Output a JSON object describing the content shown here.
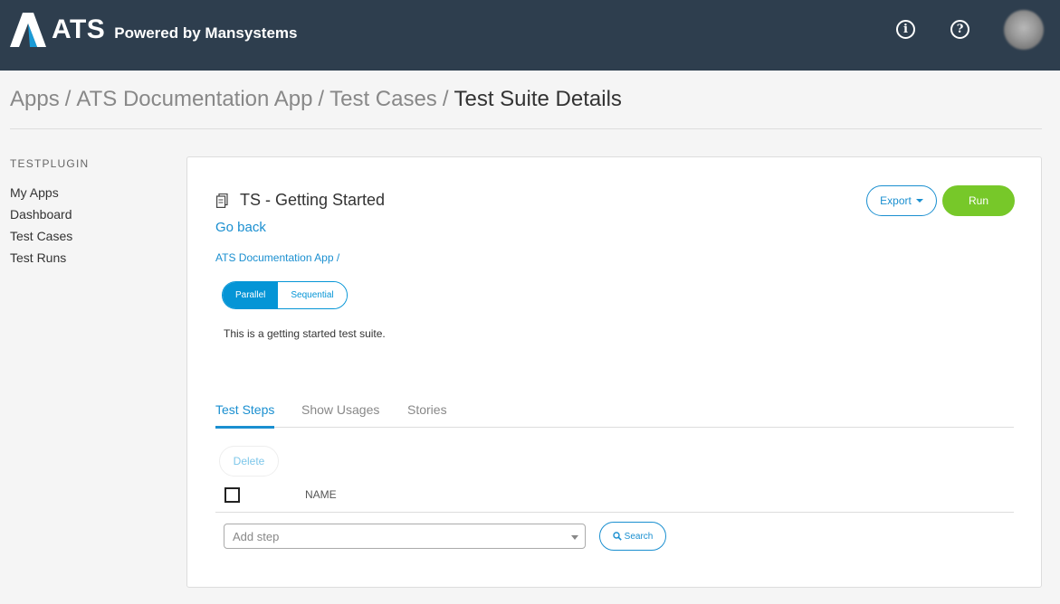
{
  "header": {
    "logo_text": "ATS",
    "powered_by": "Powered by Mansystems",
    "info_icon": "info-icon",
    "help_icon": "help-icon"
  },
  "breadcrumb": {
    "items": [
      "Apps",
      "ATS Documentation App",
      "Test Cases"
    ],
    "separator": "/",
    "current": "Test Suite Details"
  },
  "sidebar": {
    "section": "TESTPLUGIN",
    "items": [
      {
        "label": "My Apps"
      },
      {
        "label": "Dashboard"
      },
      {
        "label": "Test Cases"
      },
      {
        "label": "Test Runs"
      }
    ]
  },
  "suite": {
    "title": "TS - Getting Started",
    "go_back": "Go back",
    "app_link": "ATS Documentation App",
    "app_link_sep": "/",
    "mode_parallel": "Parallel",
    "mode_sequential": "Sequential",
    "mode_selected": "Parallel",
    "description": "This is a getting started test suite.",
    "export_label": "Export",
    "run_label": "Run"
  },
  "tabs": [
    {
      "label": "Test Steps",
      "active": true
    },
    {
      "label": "Show Usages",
      "active": false
    },
    {
      "label": "Stories",
      "active": false
    }
  ],
  "steps": {
    "delete_label": "Delete",
    "column_name": "NAME",
    "add_placeholder": "Add step",
    "search_label": "Search"
  },
  "colors": {
    "header_bg": "#2e3e4e",
    "accent": "#1a8fd0",
    "run_green": "#77c829"
  }
}
